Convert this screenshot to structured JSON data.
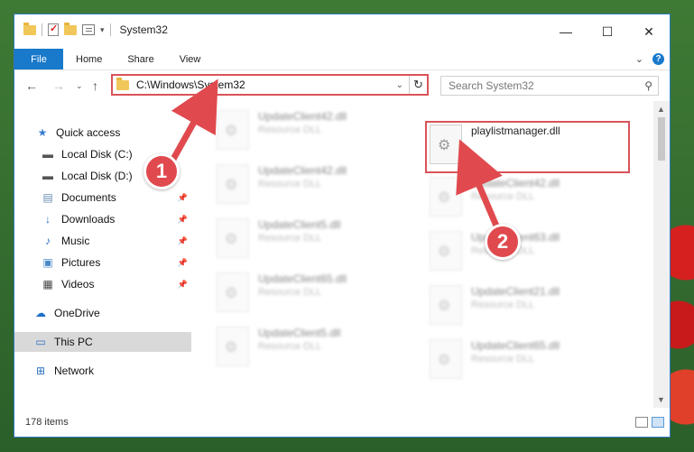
{
  "window": {
    "title": "System32"
  },
  "ribbon": {
    "tabs": [
      "File",
      "Home",
      "Share",
      "View"
    ]
  },
  "address": {
    "path": "C:\\Windows\\System32"
  },
  "search": {
    "placeholder": "Search System32"
  },
  "sidebar": {
    "items": [
      {
        "label": "Quick access",
        "icon": "star-icon"
      },
      {
        "label": "Local Disk (C:)",
        "icon": "drive-icon"
      },
      {
        "label": "Local Disk (D:)",
        "icon": "drive-icon"
      },
      {
        "label": "Documents",
        "icon": "documents-icon"
      },
      {
        "label": "Downloads",
        "icon": "download-icon"
      },
      {
        "label": "Music",
        "icon": "music-icon"
      },
      {
        "label": "Pictures",
        "icon": "pictures-icon"
      },
      {
        "label": "Videos",
        "icon": "videos-icon"
      },
      {
        "label": "OneDrive",
        "icon": "cloud-icon"
      },
      {
        "label": "This PC",
        "icon": "computer-icon",
        "selected": true
      },
      {
        "label": "Network",
        "icon": "network-icon"
      }
    ]
  },
  "files": {
    "highlighted": {
      "name": "playlistmanager.dll"
    },
    "left_column": [
      {
        "name": "UpdateClient42.dll",
        "type": "Resource DLL"
      },
      {
        "name": "UpdateClient42.dll",
        "type": "Resource DLL"
      },
      {
        "name": "UpdateClient5.dll",
        "type": "Resource DLL"
      },
      {
        "name": "UpdateClient65.dll",
        "type": "Resource DLL"
      },
      {
        "name": "UpdateClient5.dll",
        "type": "Resource DLL"
      }
    ],
    "right_column": [
      {
        "name": "UpdateClient42.dll",
        "type": "Resource DLL"
      },
      {
        "name": "UpdateClient63.dll",
        "type": "Resource DLL"
      },
      {
        "name": "UpdateClient21.dll",
        "type": "Resource DLL"
      },
      {
        "name": "UpdateClient65.dll",
        "type": "Resource DLL"
      }
    ]
  },
  "status": {
    "item_count": "178 items"
  },
  "callouts": {
    "one": "1",
    "two": "2"
  },
  "colors": {
    "accent": "#1979ca",
    "highlight": "#d9535a"
  }
}
